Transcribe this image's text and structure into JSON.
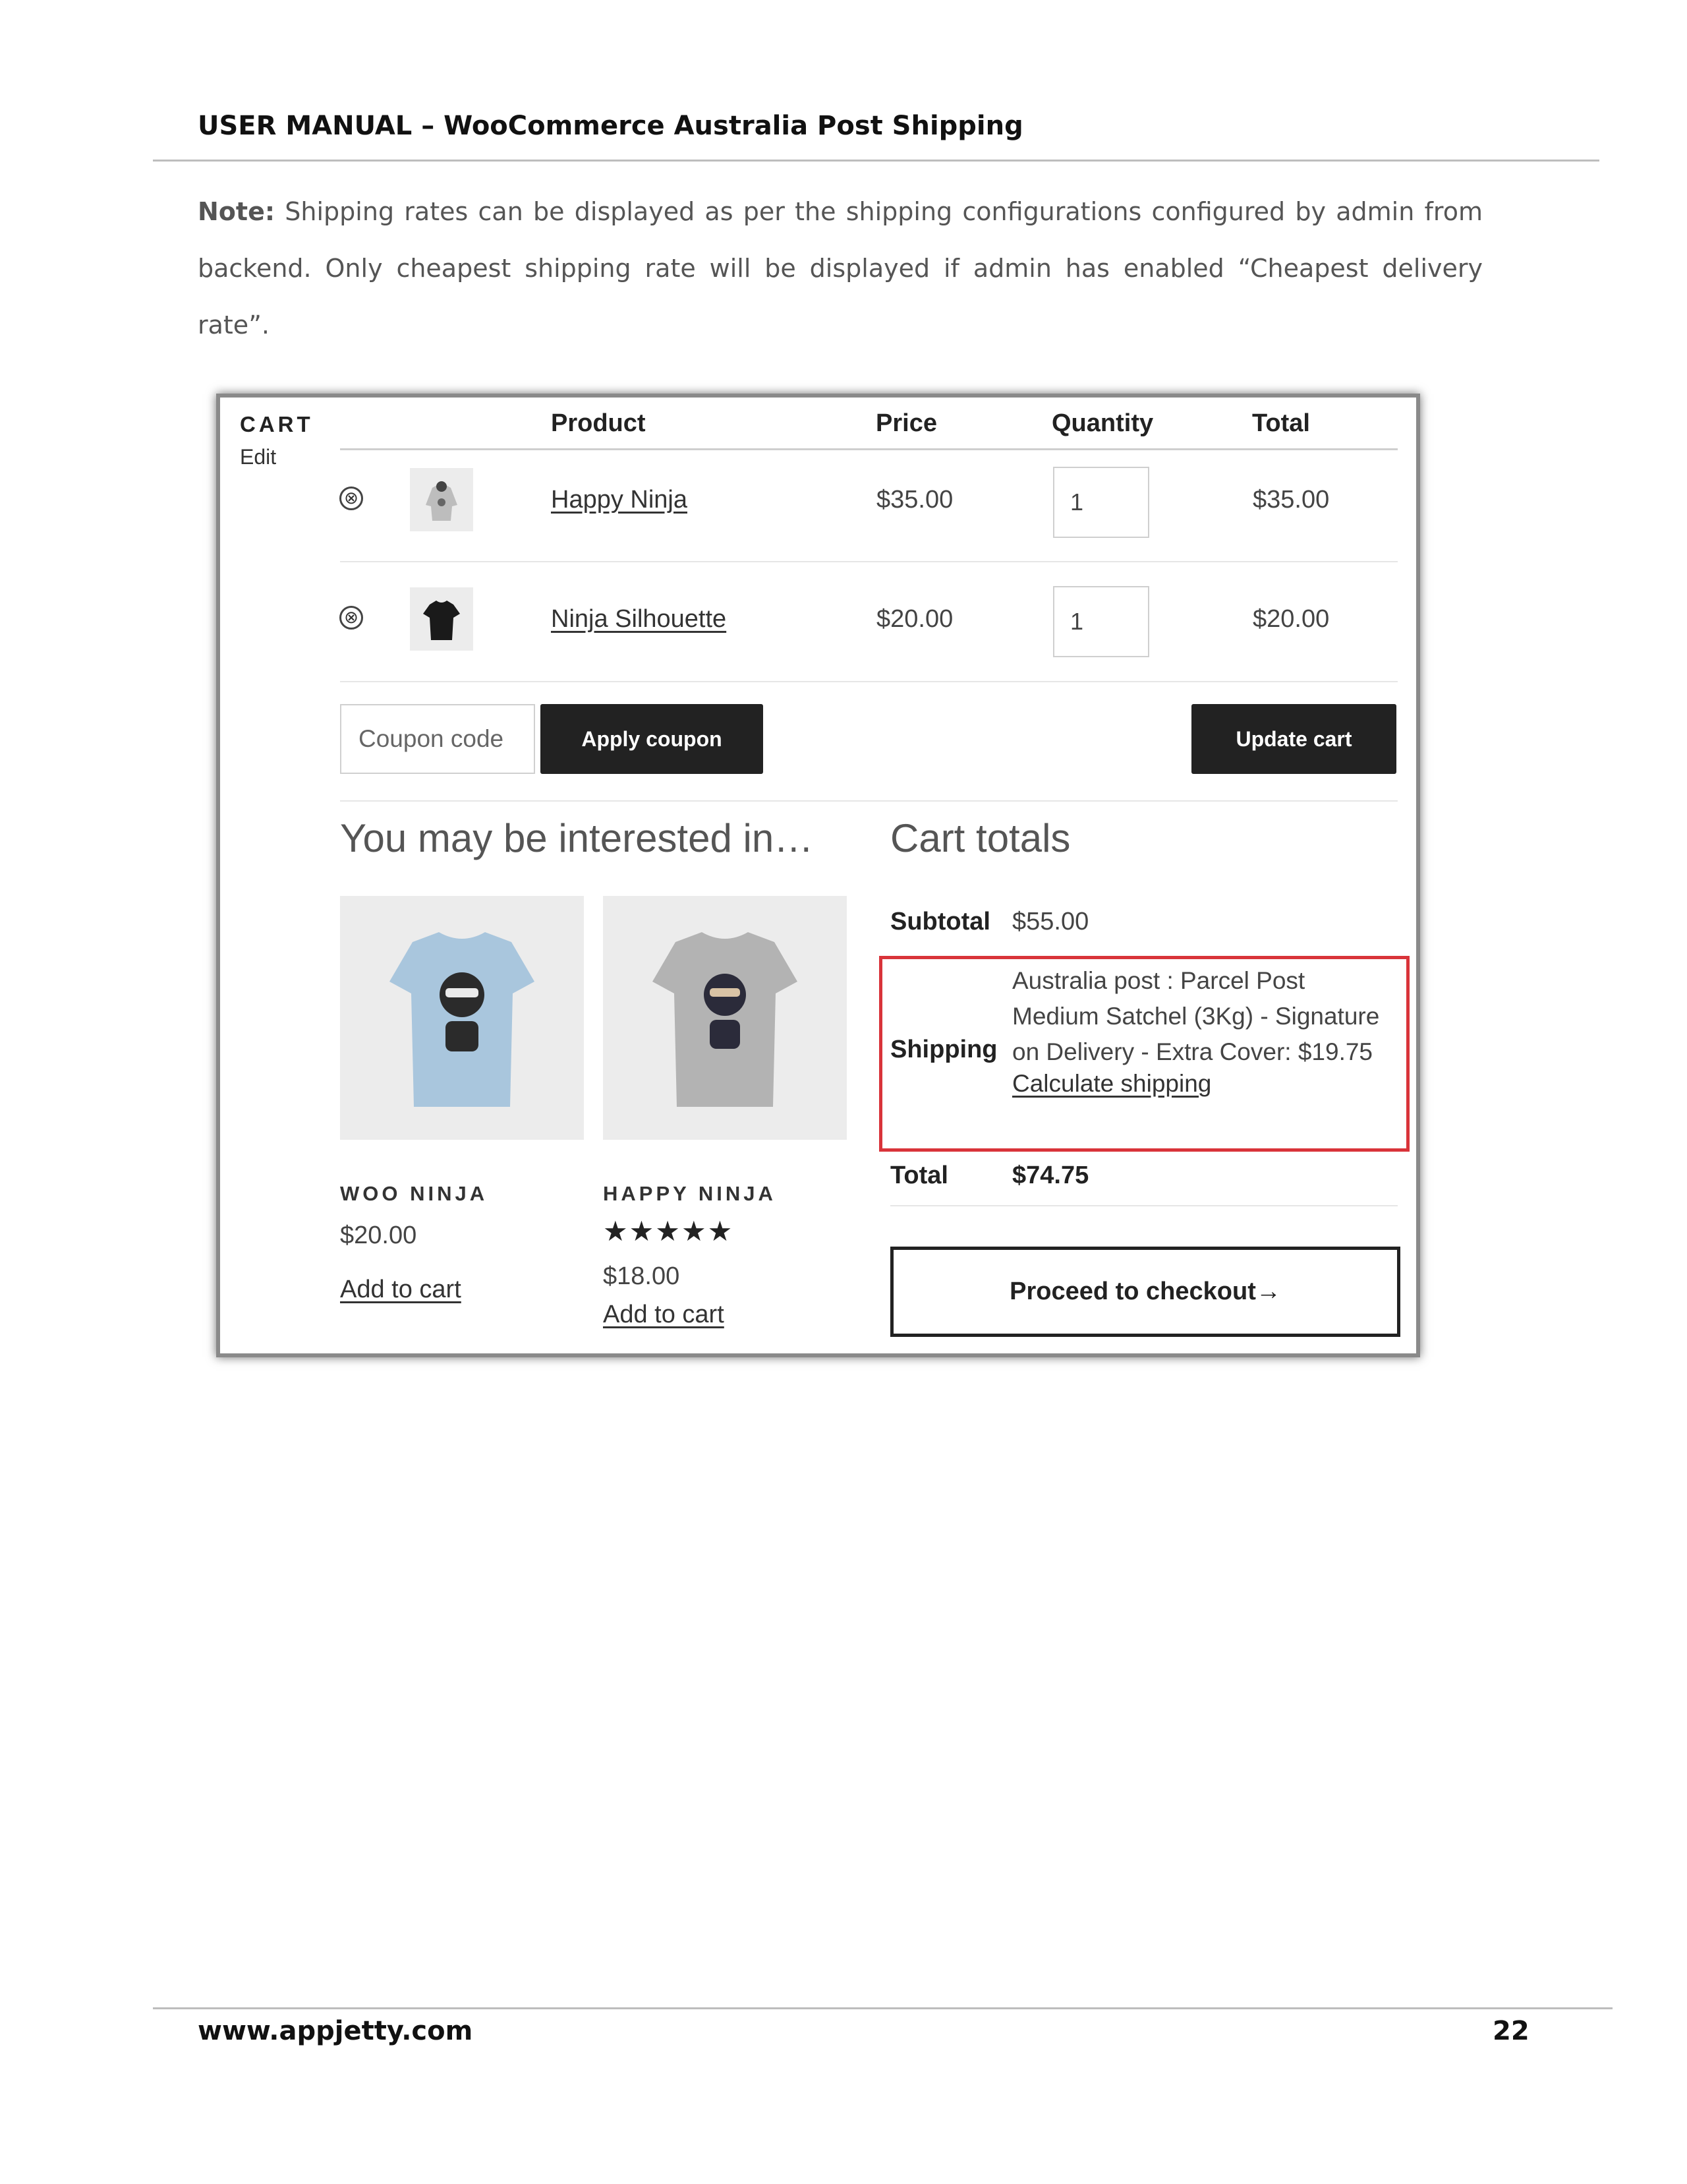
{
  "document": {
    "header_title": "USER MANUAL – WooCommerce Australia Post Shipping",
    "note_label": "Note:",
    "note_text": "Shipping rates can be displayed as per the shipping configurations configured by admin from backend. Only cheapest shipping rate will be displayed if admin has enabled “Cheapest delivery rate”.",
    "footer_url": "www.appjetty.com",
    "page_number": "22"
  },
  "cart": {
    "label": "CART",
    "edit": "Edit",
    "columns": {
      "product": "Product",
      "price": "Price",
      "quantity": "Quantity",
      "total": "Total"
    },
    "remove_glyph": "⊗",
    "items": [
      {
        "name": "Happy Ninja",
        "price": "$35.00",
        "quantity": "1",
        "total": "$35.00",
        "thumb_icon": "grey-hoodie-icon",
        "thumb_color": "#bdbdbd"
      },
      {
        "name": "Ninja Silhouette",
        "price": "$20.00",
        "quantity": "1",
        "total": "$20.00",
        "thumb_icon": "black-tshirt-icon",
        "thumb_color": "#1a1a1a"
      }
    ],
    "coupon_placeholder": "Coupon code",
    "apply_coupon": "Apply coupon",
    "update_cart": "Update cart"
  },
  "related": {
    "title": "You may be interested in…",
    "products": [
      {
        "name": "WOO NINJA",
        "price": "$20.00",
        "add_to_cart": "Add to cart",
        "shirt_color": "#a9c6dd",
        "icon": "blue-ninja-tshirt-icon"
      },
      {
        "name": "HAPPY NINJA",
        "rating": 5,
        "stars": "★★★★★",
        "price": "$18.00",
        "add_to_cart": "Add to cart",
        "shirt_color": "#b3b3b3",
        "icon": "grey-ninja-tshirt-icon"
      }
    ]
  },
  "cart_totals": {
    "title": "Cart totals",
    "subtotal_label": "Subtotal",
    "subtotal_value": "$55.00",
    "shipping_label": "Shipping",
    "shipping_line1": "Australia post : Parcel Post",
    "shipping_line2": "Medium Satchel (3Kg) - Signature",
    "shipping_line3": "on Delivery - Extra Cover: $19.75",
    "calculate_shipping": "Calculate shipping",
    "total_label": "Total",
    "total_value": "$74.75",
    "checkout_button": "Proceed to checkout→",
    "highlight_color": "#d9343a"
  }
}
